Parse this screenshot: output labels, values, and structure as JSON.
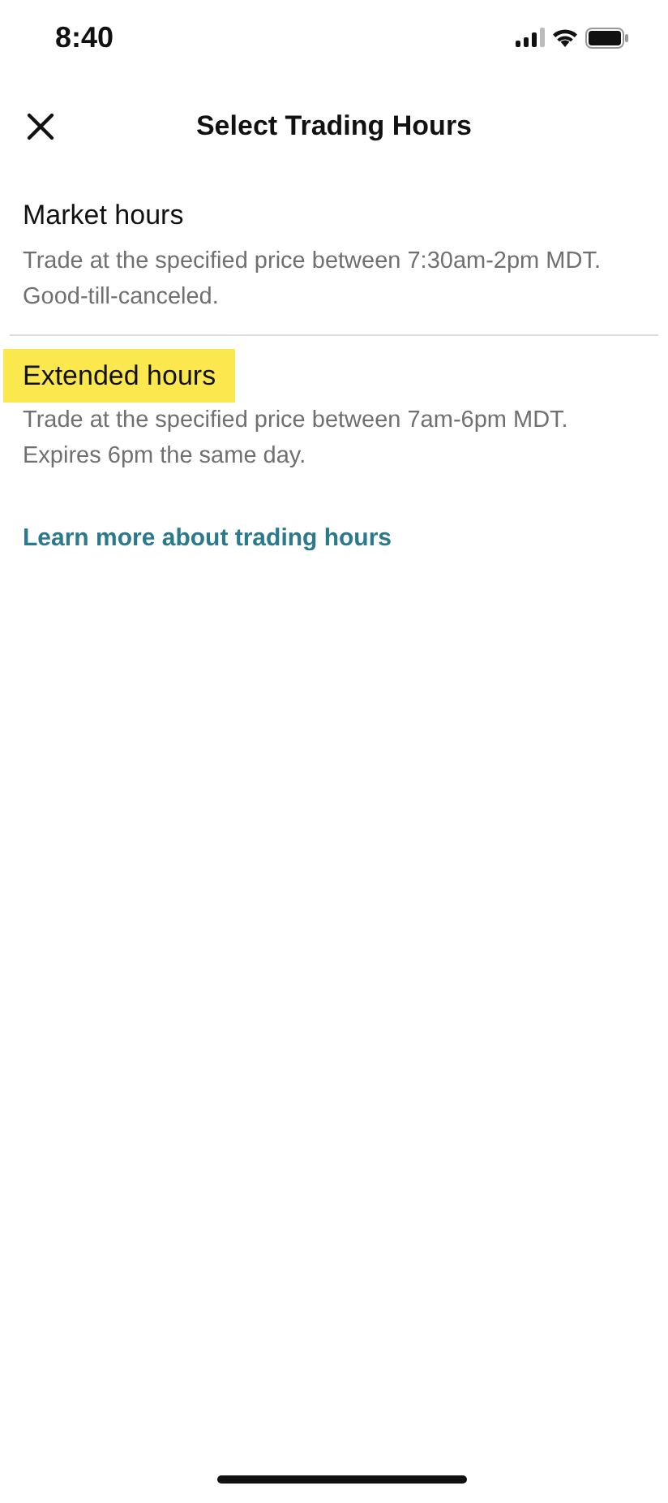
{
  "status_bar": {
    "time": "8:40"
  },
  "header": {
    "title": "Select Trading Hours"
  },
  "options": [
    {
      "title": "Market hours",
      "description": "Trade at the specified price between 7:30am-2pm MDT. Good-till-canceled.",
      "selected": false
    },
    {
      "title": "Extended hours",
      "description": "Trade at the specified price between 7am-6pm MDT. Expires 6pm the same day.",
      "selected": true
    }
  ],
  "link": "Learn more about trading hours"
}
